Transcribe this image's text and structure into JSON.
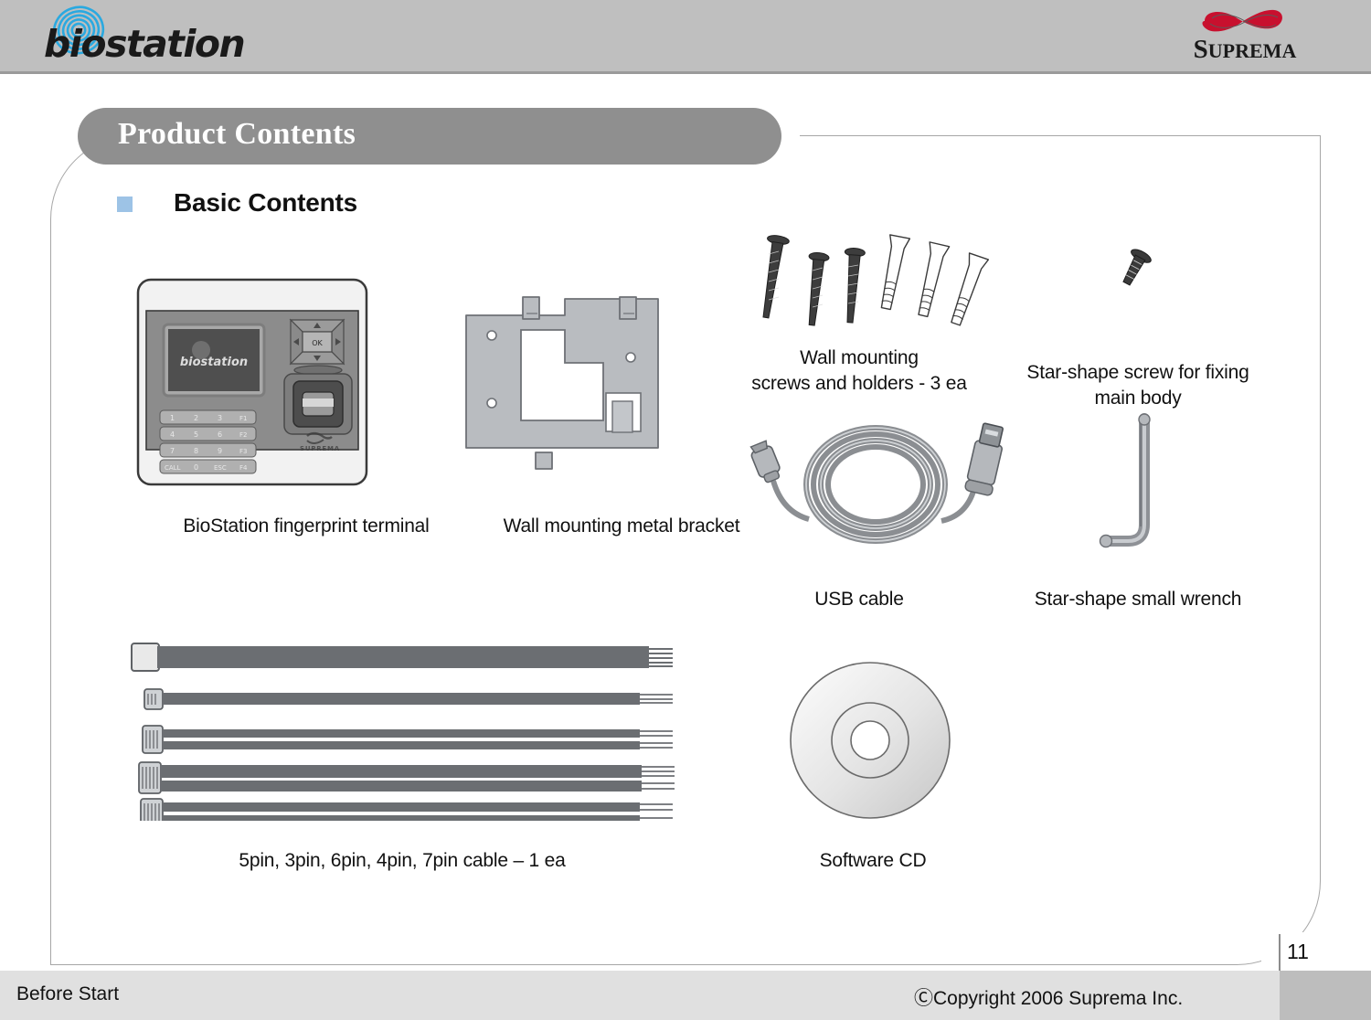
{
  "header": {
    "brand_logo_text": "biostation",
    "company_logo_text": "SUPREMA",
    "brand_accent_color": "#2aa9e0",
    "company_accent_color": "#c8102e",
    "band_color": "#bfbfbf"
  },
  "slide": {
    "title": "Product Contents",
    "section_heading": "Basic Contents",
    "bullet_color": "#9dc3e6",
    "title_pill_color": "#8f8f8f"
  },
  "items": [
    {
      "id": "terminal",
      "caption": "BioStation fingerprint terminal"
    },
    {
      "id": "bracket",
      "caption": "Wall mounting metal bracket"
    },
    {
      "id": "screws",
      "caption_line1": "Wall mounting",
      "caption_line2": "screws and holders - 3 ea"
    },
    {
      "id": "starscrew",
      "caption_line1": "Star-shape screw for fixing",
      "caption_line2": "main body"
    },
    {
      "id": "usb",
      "caption": "USB cable"
    },
    {
      "id": "wrench",
      "caption": "Star-shape small wrench"
    },
    {
      "id": "cables",
      "caption": "5pin, 3pin, 6pin, 4pin, 7pin cable – 1 ea"
    },
    {
      "id": "cd",
      "caption": "Software CD"
    }
  ],
  "device": {
    "screen_label": "biostation",
    "brand_mark": "SUPREMA",
    "dpad_center_label": "OK",
    "keypad_rows": [
      [
        "1",
        "2",
        "3",
        "F1"
      ],
      [
        "4",
        "5",
        "6",
        "F2"
      ],
      [
        "7",
        "8",
        "9",
        "F3"
      ],
      [
        "CALL",
        "0",
        "ESC",
        "F4"
      ]
    ]
  },
  "footer": {
    "left": "Before Start",
    "center": "ⒸCopyright 2006 Suprema Inc.",
    "page_number": "11"
  }
}
